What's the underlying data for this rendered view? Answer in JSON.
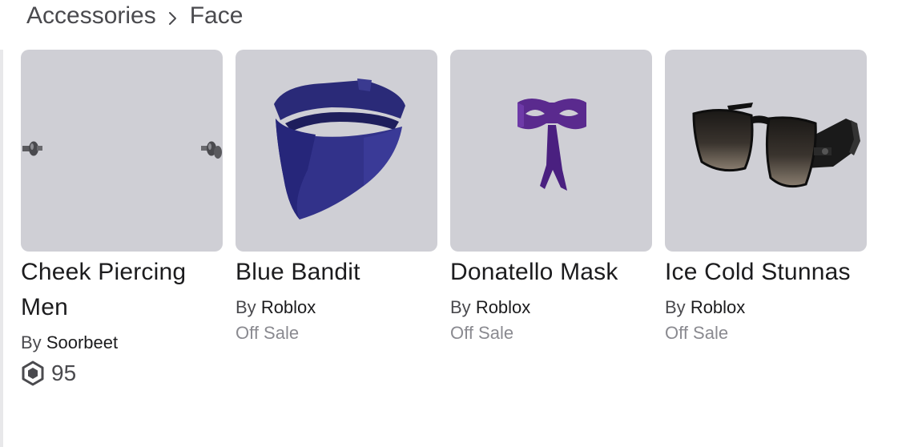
{
  "breadcrumb": {
    "parent": "Accessories",
    "separator_icon": "chevron-right-icon",
    "current": "Face"
  },
  "items": [
    {
      "name": "Cheek Piercing Men",
      "by_label": "By",
      "creator": "Soorbeet",
      "price": "95",
      "currency_icon": "robux-icon",
      "thumbnail": "cheek-piercing"
    },
    {
      "name": "Blue Bandit",
      "by_label": "By",
      "creator": "Roblox",
      "status": "Off Sale",
      "thumbnail": "blue-bandana"
    },
    {
      "name": "Donatello Mask",
      "by_label": "By",
      "creator": "Roblox",
      "status": "Off Sale",
      "thumbnail": "purple-eye-mask"
    },
    {
      "name": "Ice Cold Stunnas",
      "by_label": "By",
      "creator": "Roblox",
      "status": "Off Sale",
      "thumbnail": "sunglasses"
    }
  ],
  "colors": {
    "thumbnail_bg": "#cfcfd5",
    "text_primary": "#1c1c1e",
    "text_secondary": "#4a4a4e",
    "text_muted": "#8a8a90"
  }
}
